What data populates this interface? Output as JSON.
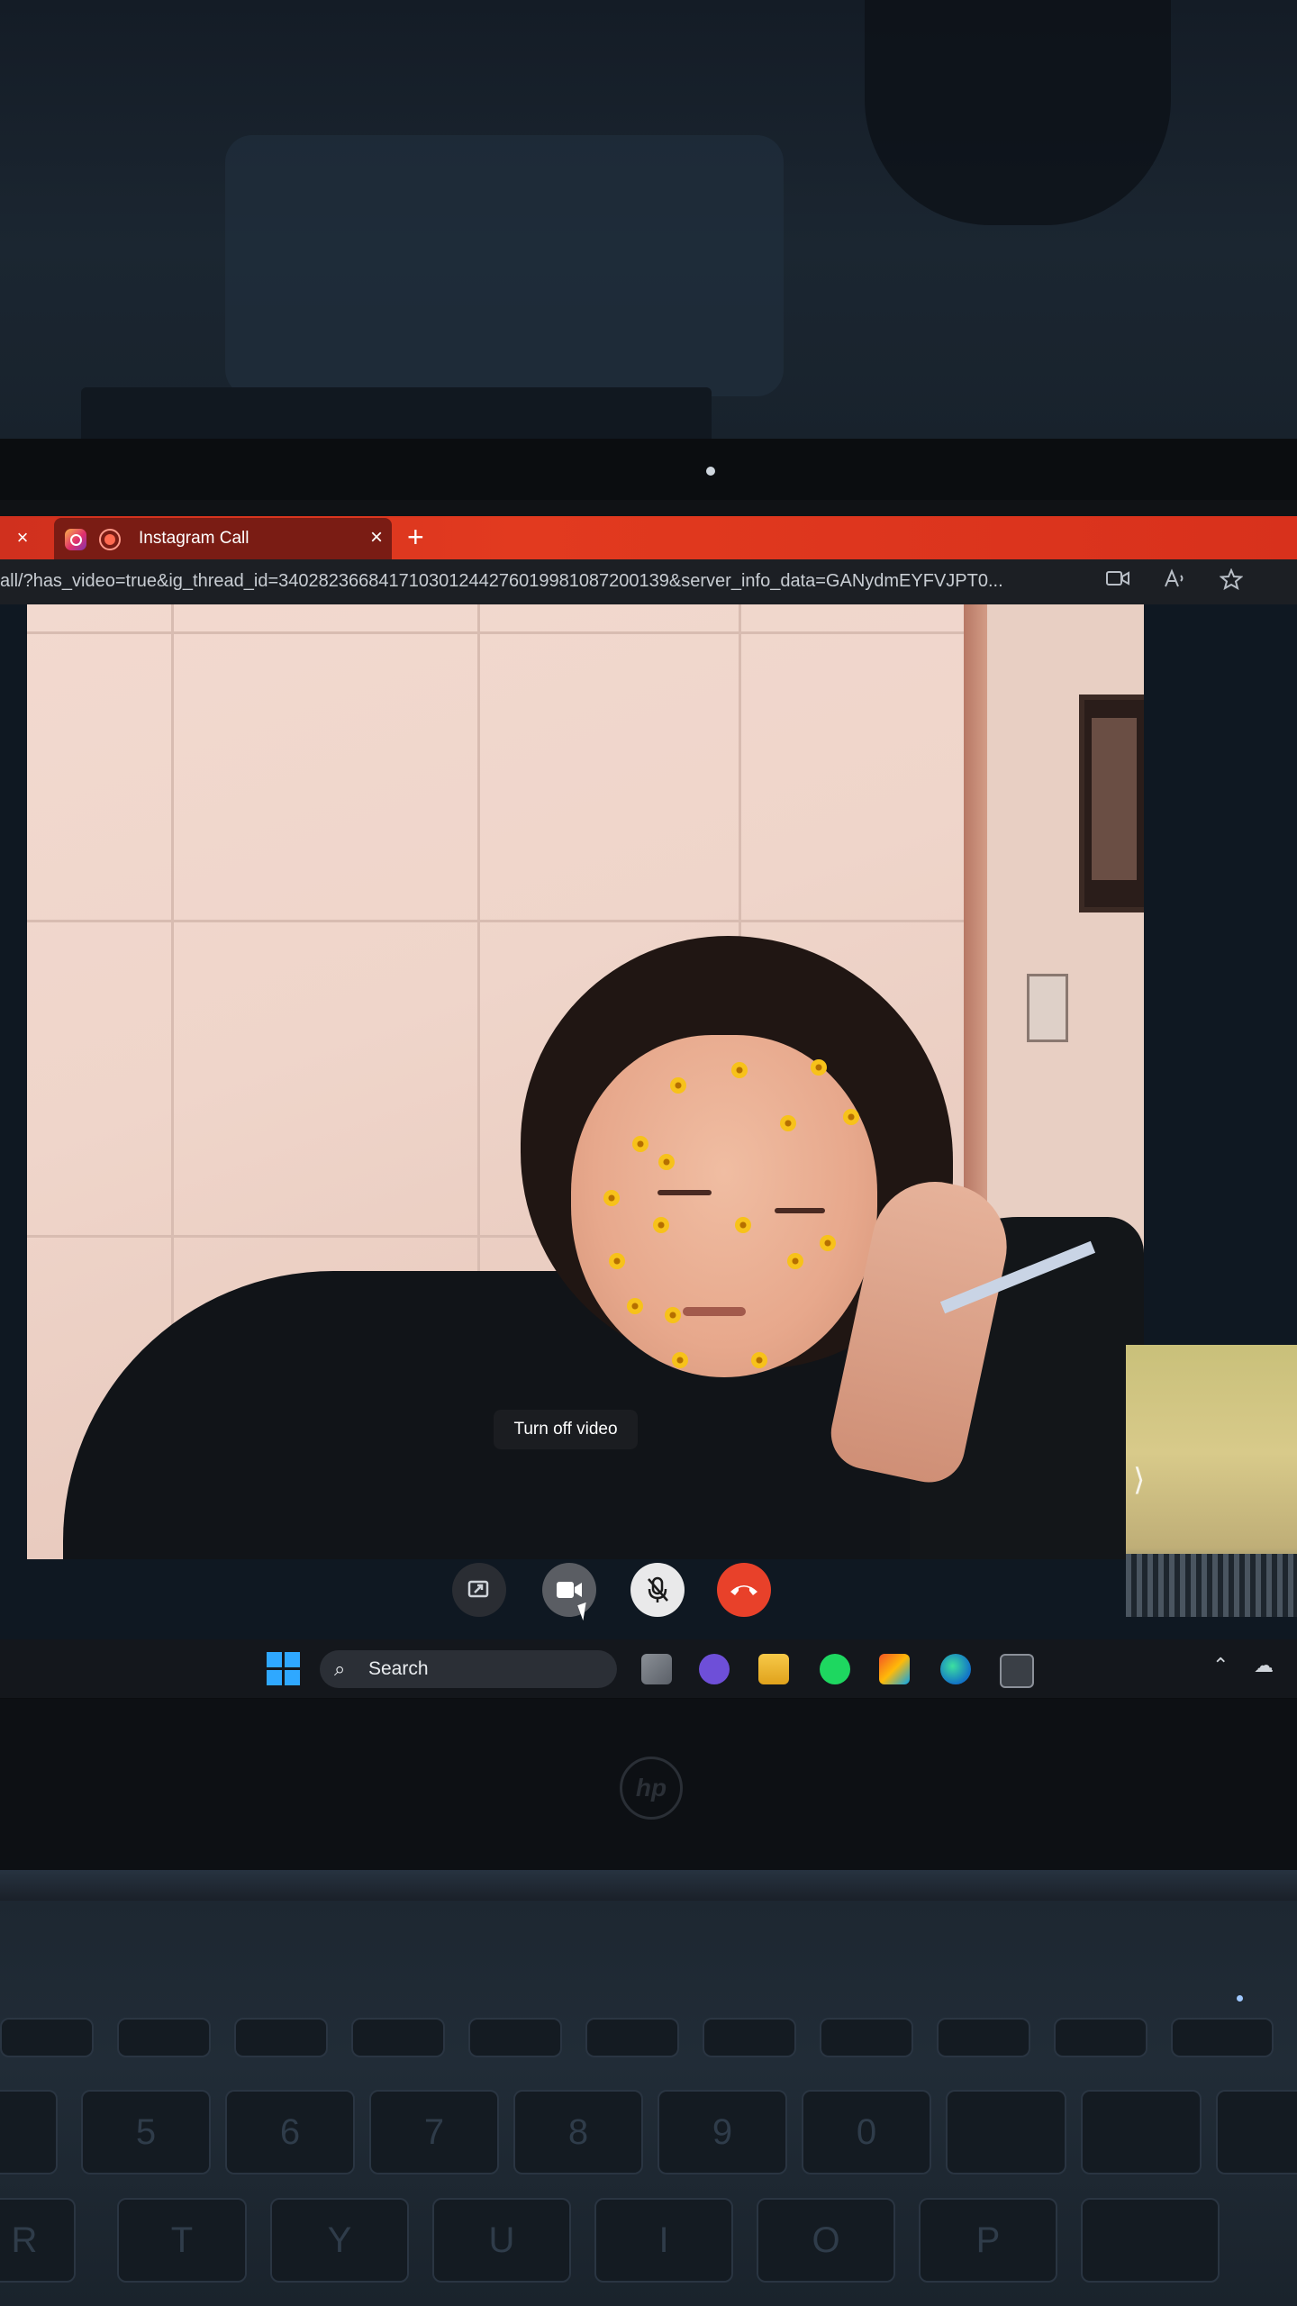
{
  "browser": {
    "tab": {
      "title": "Instagram Call",
      "close_glyph": "×"
    },
    "new_tab_glyph": "+",
    "window_close_glyph": "×",
    "url": "all/?has_video=true&ig_thread_id=340282366841710301244276019981087200139&server_info_data=GANydmEYFVJPT0...",
    "address_icons": [
      "video-camera-icon",
      "read-aloud-icon",
      "favorite-star-icon"
    ]
  },
  "call": {
    "tooltip": "Turn off video",
    "controls": [
      {
        "name": "share-screen-button",
        "icon": "screen-share-icon"
      },
      {
        "name": "turn-off-video-button",
        "icon": "video-camera-icon"
      },
      {
        "name": "mute-microphone-button",
        "icon": "microphone-off-icon"
      },
      {
        "name": "end-call-button",
        "icon": "phone-hangup-icon",
        "color": "#e8412a"
      }
    ],
    "self_view_chevron": "⟩"
  },
  "taskbar": {
    "search_label": "Search",
    "apps": [
      "task-view-icon",
      "teams-icon",
      "file-explorer-icon",
      "spotify-icon",
      "microsoft-store-icon",
      "edge-icon",
      "app-icon"
    ],
    "tray": [
      "chevron-up-icon",
      "onedrive-cloud-icon"
    ]
  },
  "keyboard": {
    "number_row": [
      "5",
      "6",
      "7",
      "8",
      "9",
      "0"
    ],
    "letter_row": [
      "R",
      "T",
      "Y",
      "U",
      "I",
      "O",
      "P"
    ]
  },
  "colors": {
    "tab_bar_red": "#e23a1f",
    "end_call_red": "#e8412a",
    "windows_blue": "#2fa8ff"
  }
}
